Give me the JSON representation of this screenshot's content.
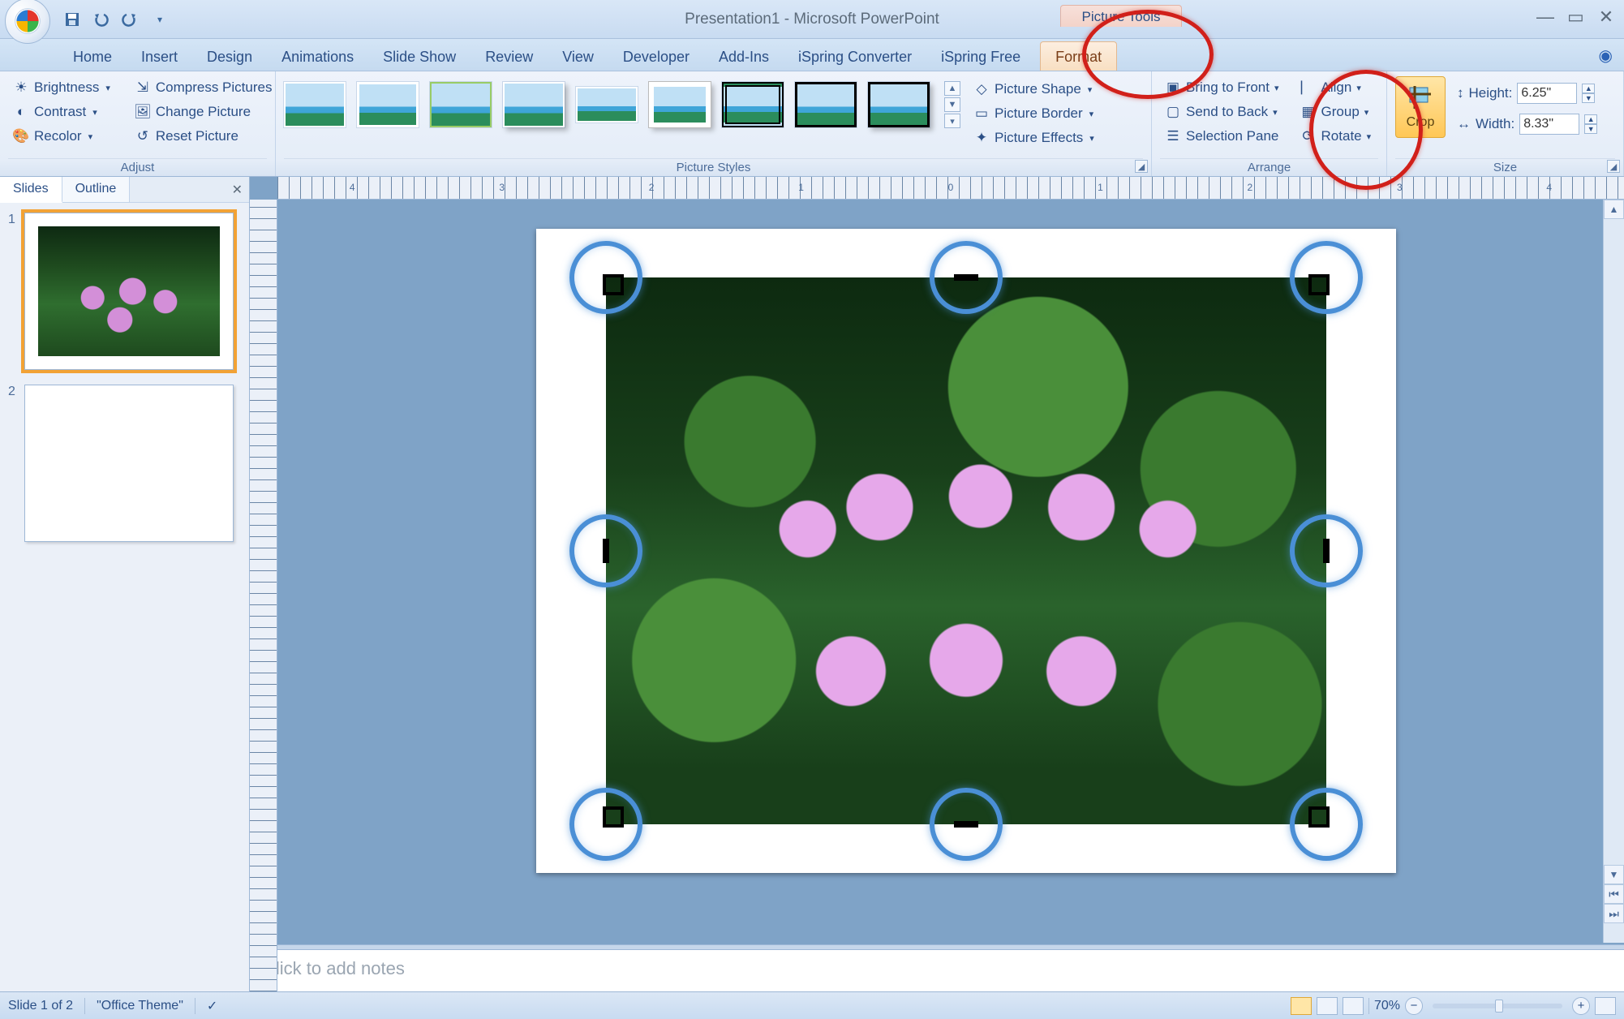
{
  "title": "Presentation1 - Microsoft PowerPoint",
  "context_tab_title": "Picture Tools",
  "tabs": {
    "home": "Home",
    "insert": "Insert",
    "design": "Design",
    "animations": "Animations",
    "slideshow": "Slide Show",
    "review": "Review",
    "view": "View",
    "developer": "Developer",
    "addins": "Add-Ins",
    "ispring_conv": "iSpring Converter",
    "ispring_free": "iSpring Free",
    "format": "Format"
  },
  "ribbon": {
    "adjust": {
      "label": "Adjust",
      "brightness": "Brightness",
      "contrast": "Contrast",
      "recolor": "Recolor",
      "compress": "Compress Pictures",
      "change": "Change Picture",
      "reset": "Reset Picture"
    },
    "styles": {
      "label": "Picture Styles",
      "shape": "Picture Shape",
      "border": "Picture Border",
      "effects": "Picture Effects"
    },
    "arrange": {
      "label": "Arrange",
      "front": "Bring to Front",
      "back": "Send to Back",
      "selection": "Selection Pane",
      "align": "Align",
      "group": "Group",
      "rotate": "Rotate"
    },
    "size": {
      "label": "Size",
      "crop": "Crop",
      "height_label": "Height:",
      "height_value": "6.25\"",
      "width_label": "Width:",
      "width_value": "8.33\""
    }
  },
  "panel": {
    "slides_tab": "Slides",
    "outline_tab": "Outline"
  },
  "ruler_labels": [
    "4",
    "3",
    "2",
    "1",
    "0",
    "1",
    "2",
    "3",
    "4"
  ],
  "notes_placeholder": "Click to add notes",
  "status": {
    "slide_info": "Slide 1 of 2",
    "theme": "\"Office Theme\"",
    "zoom_pct": "70%"
  }
}
